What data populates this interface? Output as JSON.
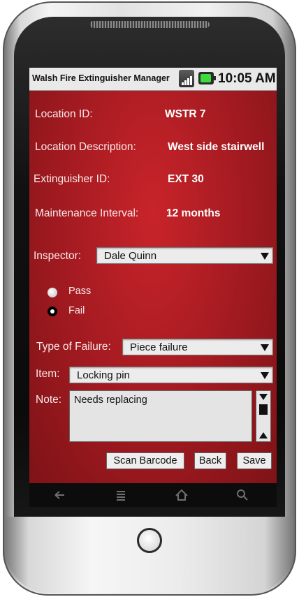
{
  "status_bar": {
    "app_title": "Walsh Fire Extinguisher Manager",
    "time": "10:05 AM"
  },
  "fields": {
    "location_id": {
      "label": "Location ID:",
      "value": "WSTR 7"
    },
    "location_description": {
      "label": "Location Description:",
      "value": "West side stairwell"
    },
    "extinguisher_id": {
      "label": "Extinguisher ID:",
      "value": "EXT 30"
    },
    "maintenance_interval": {
      "label": "Maintenance Interval:",
      "value": "12 months"
    }
  },
  "inspector": {
    "label": "Inspector:",
    "selected": "Dale Quinn"
  },
  "result": {
    "pass_label": "Pass",
    "fail_label": "Fail",
    "selected": "Fail"
  },
  "failure_type": {
    "label": "Type of Failure:",
    "selected": "Piece failure"
  },
  "item": {
    "label": "Item:",
    "selected": "Locking pin"
  },
  "note": {
    "label": "Note:",
    "value": "Needs replacing"
  },
  "buttons": {
    "scan_barcode": "Scan Barcode",
    "back": "Back",
    "save": "Save"
  },
  "nav_icons": [
    "back-icon",
    "menu-icon",
    "home-icon",
    "search-icon"
  ],
  "colors": {
    "screen_red": "#b01e24",
    "status_bar": "#e9e9e9",
    "battery_green": "#3ddc3d"
  }
}
